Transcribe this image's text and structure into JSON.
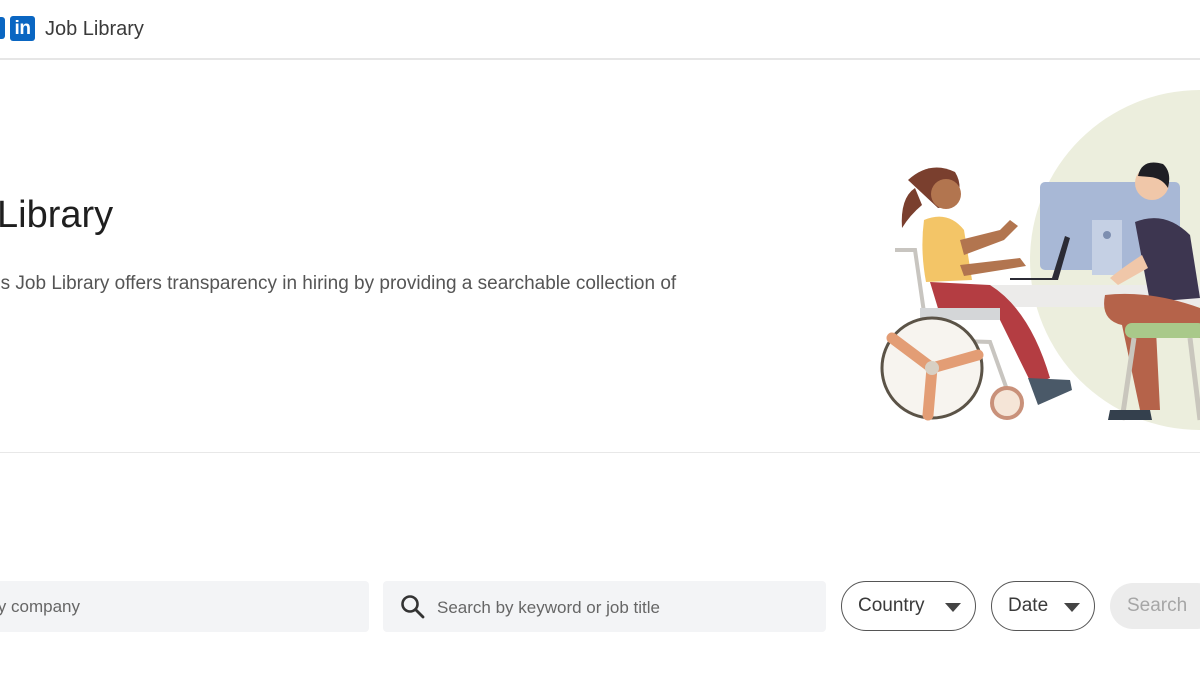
{
  "header": {
    "logo_text": "in",
    "title": "Job Library"
  },
  "hero": {
    "title": "Library",
    "description": "'s Job Library offers transparency in hiring by providing a searchable collection of"
  },
  "search": {
    "company_placeholder": "rch by company",
    "keyword_placeholder": "Search by keyword or job title",
    "country_label": "Country",
    "date_label": "Date",
    "search_button_label": "Search"
  },
  "icons": {
    "search": "search-icon",
    "dropdown": "caret-down-icon"
  },
  "colors": {
    "brand": "#0a66c2",
    "accent_disabled": "#ececec"
  }
}
